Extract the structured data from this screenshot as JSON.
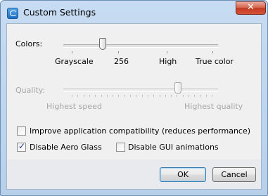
{
  "window": {
    "title": "Custom Settings",
    "close_symbol": "✕"
  },
  "colors": {
    "label": "Colors:",
    "tick_labels": [
      "Grayscale",
      "256",
      "High",
      "True color"
    ],
    "level": 0.25
  },
  "quality": {
    "label": "Quality:",
    "low_label": "Highest speed",
    "high_label": "Highest quality",
    "level": 0.75
  },
  "options": {
    "compat": {
      "label": "Improve application compatibility (reduces performance)",
      "checked": false
    },
    "aero": {
      "label": "Disable Aero Glass",
      "checked": true
    },
    "gui_anim": {
      "label": "Disable GUI animations",
      "checked": false
    }
  },
  "buttons": {
    "ok": "OK",
    "cancel": "Cancel"
  },
  "colors_accent": {
    "close_red": "#c23a22",
    "frame_blue": "#b7d0ea",
    "default_border": "#3c7fb1"
  }
}
